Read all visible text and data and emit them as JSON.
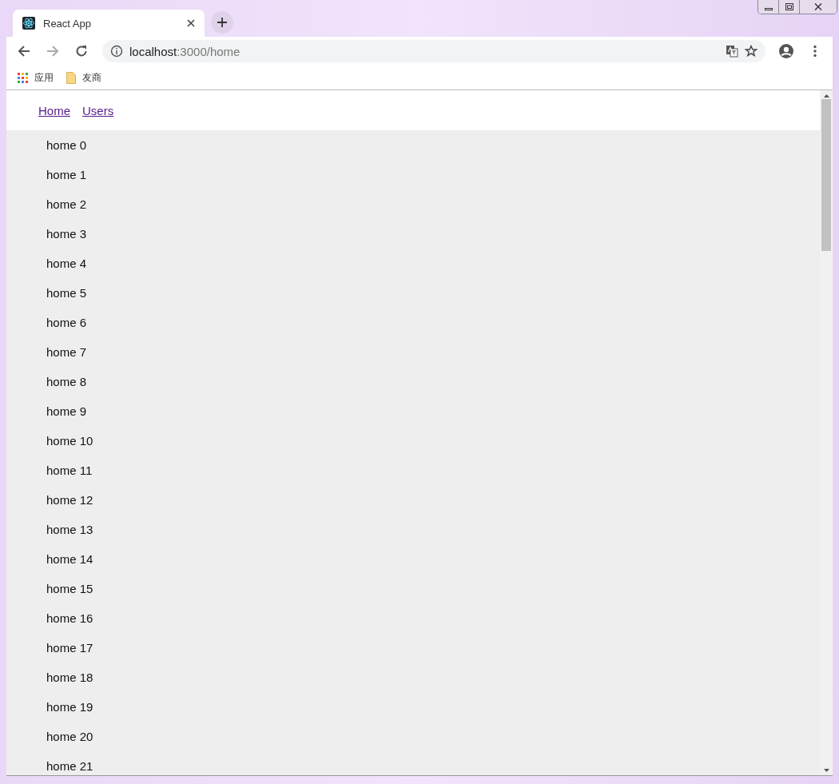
{
  "browser": {
    "tabs": [
      {
        "title": "React App",
        "selected": true
      }
    ],
    "address": {
      "host": "localhost",
      "path": ":3000/home"
    },
    "bookmarks": [
      {
        "label": "应用",
        "kind": "apps"
      },
      {
        "label": "友商",
        "kind": "folder"
      }
    ]
  },
  "nav": [
    {
      "label": "Home"
    },
    {
      "label": "Users"
    }
  ],
  "items": [
    "home 0",
    "home 1",
    "home 2",
    "home 3",
    "home 4",
    "home 5",
    "home 6",
    "home 7",
    "home 8",
    "home 9",
    "home 10",
    "home 11",
    "home 12",
    "home 13",
    "home 14",
    "home 15",
    "home 16",
    "home 17",
    "home 18",
    "home 19",
    "home 20",
    "home 21"
  ]
}
